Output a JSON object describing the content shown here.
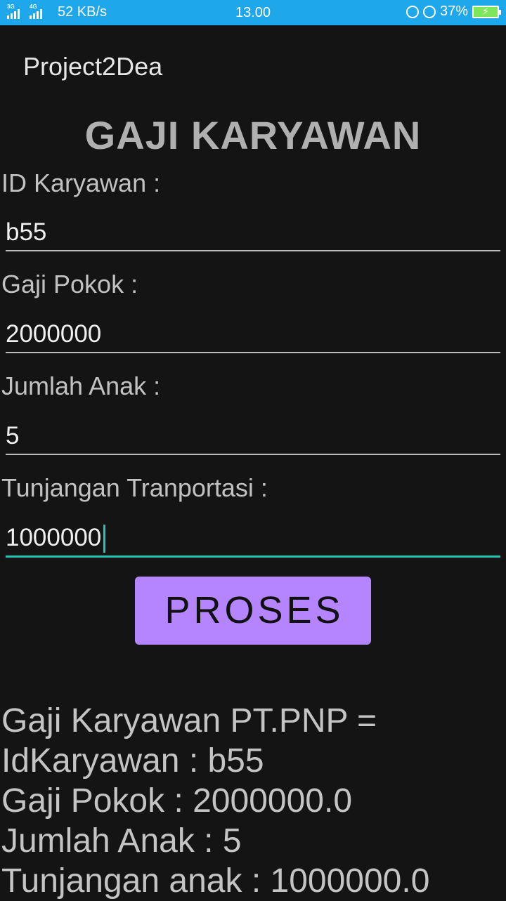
{
  "status_bar": {
    "network_left": "3G",
    "network_right": "4G",
    "speed": "52 KB/s",
    "time": "13.00",
    "battery_percent": "37%",
    "color": "#1ea7ea"
  },
  "app": {
    "title": "Project2Dea"
  },
  "heading": "GAJI KARYAWAN",
  "form": {
    "id_label": "ID Karyawan :",
    "id_value": "b55",
    "gaji_label": "Gaji Pokok :",
    "gaji_value": "2000000",
    "anak_label": "Jumlah Anak :",
    "anak_value": "5",
    "tunjangan_label": "Tunjangan Tranportasi  :",
    "tunjangan_value": "1000000"
  },
  "button": {
    "label": "PROSES",
    "color": "#b584ff"
  },
  "result": {
    "line1": "Gaji Karyawan PT.PNP =",
    "line2": "IdKaryawan : b55",
    "line3": "Gaji Pokok : 2000000.0",
    "line4": "Jumlah Anak : 5",
    "line5": "Tunjangan anak : 1000000.0"
  },
  "accent_color": "#25c3b0"
}
